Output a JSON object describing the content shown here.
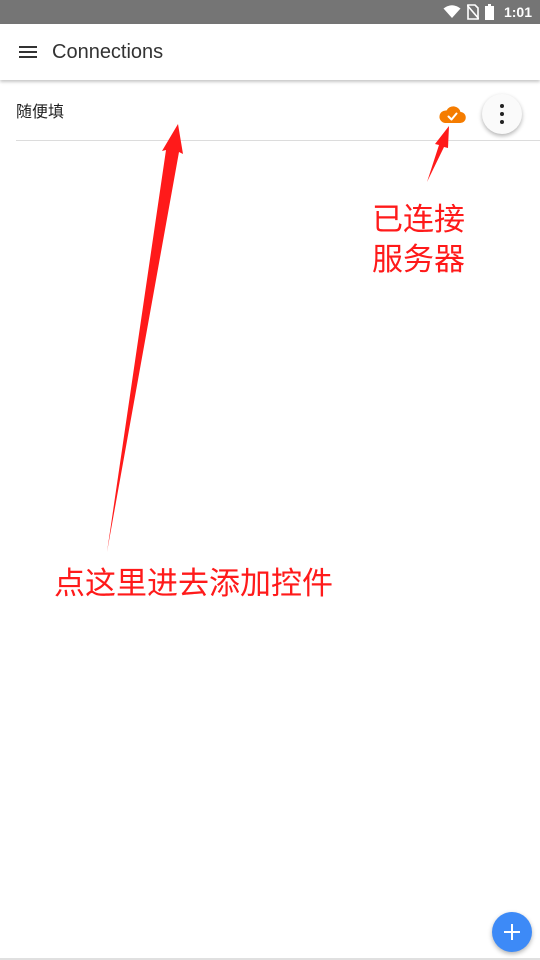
{
  "status_bar": {
    "time": "1:01",
    "icons": [
      "wifi-icon",
      "no-sim-icon",
      "battery-icon"
    ]
  },
  "app_bar": {
    "title": "Connections",
    "icon": "menu-icon"
  },
  "connections": [
    {
      "name": "随便填",
      "status_icon": "cloud-check-icon",
      "action_icon": "more-vert-icon"
    }
  ],
  "annotations": {
    "connected_line1": "已连接",
    "connected_line2": "服务器",
    "tap_hint": "点这里进去添加控件"
  },
  "fab": {
    "icon": "plus-icon"
  },
  "colors": {
    "status_bar": "#757575",
    "cloud": "#f57c00",
    "annotation": "#ff1a1a",
    "fab": "#3d8af7"
  }
}
